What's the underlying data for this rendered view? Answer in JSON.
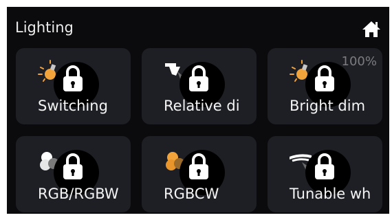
{
  "header": {
    "title": "Lighting",
    "home_icon": "home-icon"
  },
  "colors": {
    "background": "#0b0b0d",
    "tile": "#1e1f24",
    "accent_orange": "#f2a33a",
    "text": "#f4f4f4",
    "muted": "#7c7c80"
  },
  "tiles": [
    {
      "label": "Switching",
      "icon": "bulb-icon",
      "locked": true
    },
    {
      "label": "Relative di",
      "icon": "spotlight-icon",
      "locked": true
    },
    {
      "label": "Bright dim",
      "icon": "bulb-icon",
      "locked": true,
      "level": "100%"
    },
    {
      "label": "RGB/RGBW",
      "icon": "color-circles-icon",
      "locked": true
    },
    {
      "label": "RGBCW",
      "icon": "color-circles-icon",
      "locked": true
    },
    {
      "label": "Tunable wh",
      "icon": "ceiling-lamp-icon",
      "locked": true
    }
  ]
}
